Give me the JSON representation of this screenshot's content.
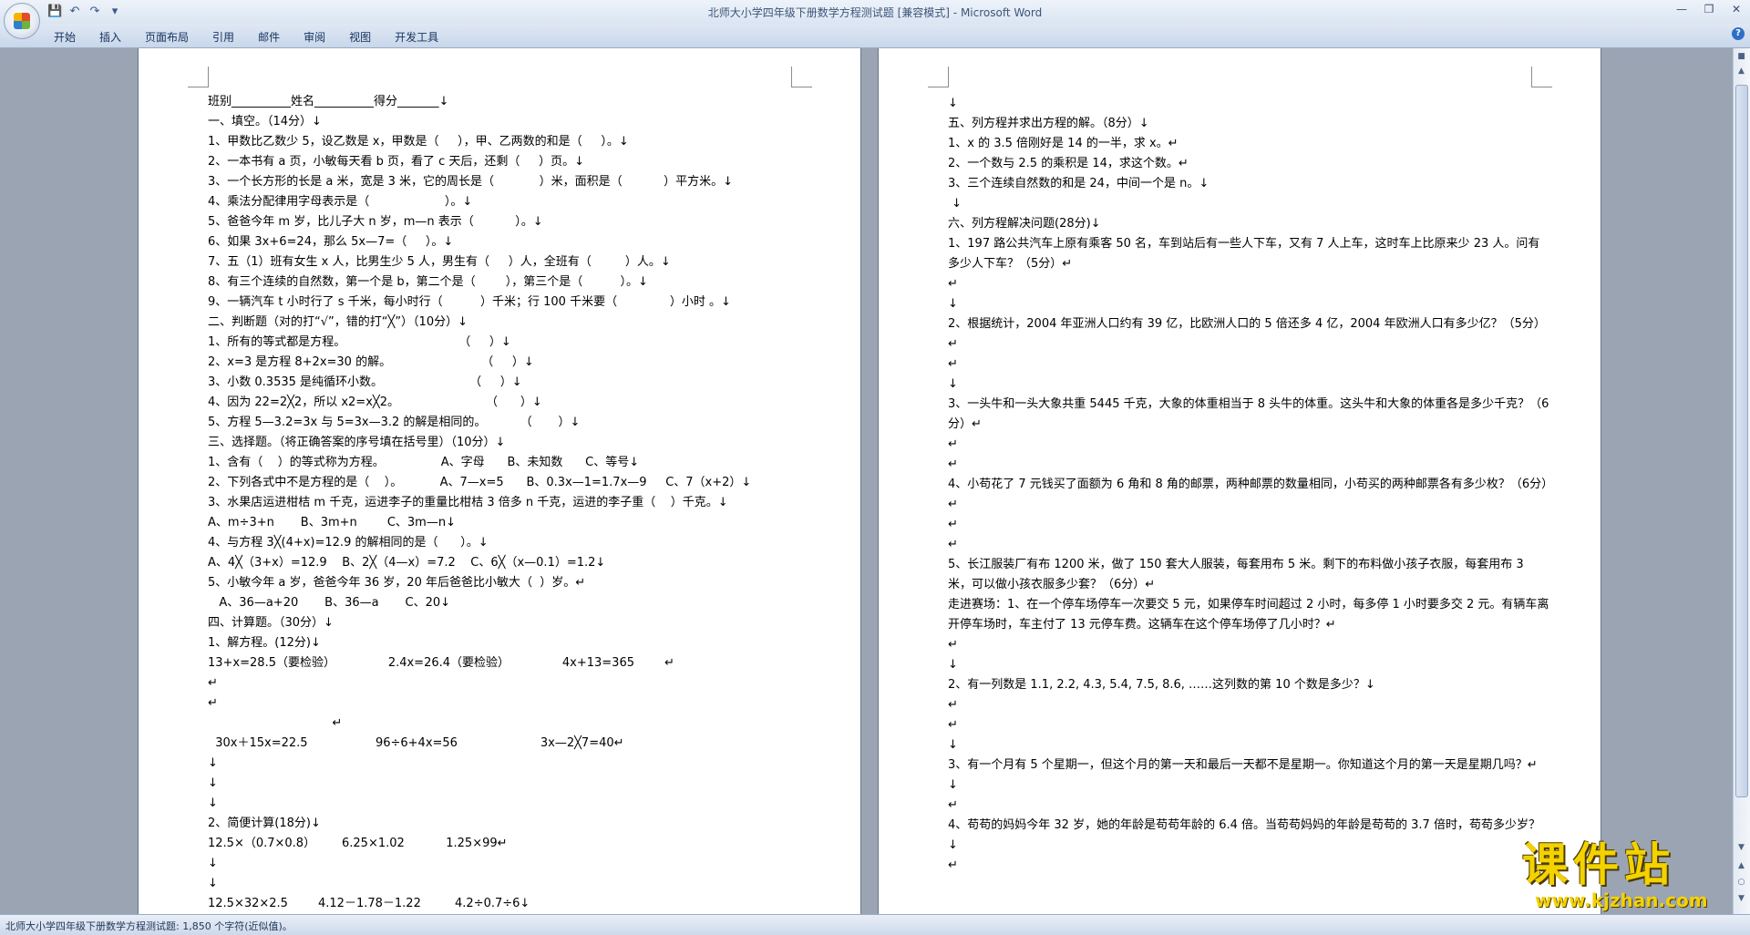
{
  "window": {
    "doc_title": "北师大小学四年级下册数学方程测试题 [兼容模式]",
    "separator": " - ",
    "app_name": "Microsoft Word"
  },
  "ribbon": {
    "tabs": [
      "开始",
      "插入",
      "页面布局",
      "引用",
      "邮件",
      "审阅",
      "视图",
      "开发工具"
    ]
  },
  "left_page": {
    "lines": [
      "班别__________姓名__________得分_______↓",
      "一、填空。（14分）↓",
      "1、甲数比乙数少 5，设乙数是 x，甲数是（     ），甲、乙两数的和是（     ）。↓",
      "2、一本书有 a 页，小敏每天看 b 页，看了 c 天后，还剩（     ）页。↓",
      "3、一个长方形的长是 a 米，宽是 3 米，它的周长是（            ）米，面积是（           ）平方米。↓",
      "4、乘法分配律用字母表示是（                    ）。↓",
      "5、爸爸今年 m 岁，比儿子大 n 岁，m—n 表示（           ）。↓",
      "6、如果 3x+6=24，那么 5x—7=（     ）。↓",
      "7、五（1）班有女生 x 人，比男生少 5 人，男生有（     ）人，全班有（         ）人。↓",
      "8、有三个连续的自然数，第一个是 b，第二个是（        ），第三个是（          ）。↓",
      "9、一辆汽车 t 小时行了 s 千米，每小时行（          ）千米；行 100 千米要（              ）小时 。↓",
      "二、判断题（对的打“√”，错的打“╳”）（10分）↓",
      "1、所有的等式都是方程。                              （     ）↓",
      "2、x=3 是方程 8+2x=30 的解。                        （     ）↓",
      "3、小数 0.3535 是纯循环小数。                       （     ）↓",
      "4、因为 22=2╳2，所以 x2=x╳2。                       （      ）↓",
      "5、方程 5—3.2=3x 与 5=3x—3.2 的解是相同的。         （       ）↓",
      "三、选择题。（将正确答案的序号填在括号里）（10分）↓",
      "1、含有（    ）的等式称为方程。               A、字母      B、未知数      C、等号↓",
      "2、下列各式中不是方程的是（    ）。          A、7—x=5      B、0.3x—1=1.7x—9     C、7（x+2）↓",
      "3、水果店运进柑桔 m 千克，运进李子的重量比柑桔 3 倍多 n 千克，运进的李子重（    ）千克。↓",
      "A、m÷3+n       B、3m+n        C、3m—n↓",
      "4、与方程 3╳(4+x)=12.9 的解相同的是（      ）。↓",
      "A、4╳（3+x）=12.9    B、2╳（4—x）=7.2    C、6╳（x—0.1）=1.2↓",
      "5、小敏今年 a 岁，爸爸今年 36 岁，20 年后爸爸比小敏大（  ）岁。↵",
      "   A、36—a+20       B、36—a       C、20↓",
      "四、计算题。（30分）↓",
      "1、解方程。(12分)↓",
      "13+x=28.5（要检验）              2.4x=26.4（要检验）              4x+13=365        ↵",
      "↵",
      "↵",
      "                                 ↵",
      "  30x＋15x=22.5                  96÷6+4x=56                      3x—2╳7=40↵",
      "↓",
      "↓",
      "↓",
      "2、简便计算(18分)↓",
      "12.5×（0.7×0.8）       6.25×1.02           1.25×99↵",
      "↓",
      "↓",
      "12.5×32×2.5        4.12－1.78－1.22         4.2÷0.7÷6↓"
    ]
  },
  "right_page": {
    "lines": [
      "↓",
      "五、列方程并求出方程的解。（8分）↓",
      "1、x 的 3.5 倍刚好是 14 的一半，求 x。↵",
      "2、一个数与 2.5 的乘积是 14，求这个数。↵",
      "3、三个连续自然数的和是 24，中间一个是 n。↓",
      " ↓",
      "六、列方程解决问题(28分)↓",
      " 1、197 路公共汽车上原有乘客 50 名，车到站后有一些人下车，又有 7 人上车，这时车上比原来少 23 人。问有多少人下车？（5分）↵",
      "↵",
      "↓",
      "  2、根据统计，2004 年亚洲人口约有 39 亿，比欧洲人口的 5 倍还多 4 亿，2004 年欧洲人口有多少亿？（5分）    ↵",
      "↵",
      "↓",
      "3、一头牛和一头大象共重 5445 千克，大象的体重相当于 8 头牛的体重。这头牛和大象的体重各是多少千克？（6分）↵",
      "↵",
      "↵",
      "4、小苟花了 7 元钱买了面额为 6 角和 8 角的邮票，两种邮票的数量相同，小苟买的两种邮票各有多少枚？（6分）↵",
      "↵",
      "↵",
      "5、长江服装厂有布 1200 米，做了 150 套大人服装，每套用布 5 米。剩下的布料做小孩子衣服，每套用布 3 米，可以做小孩衣服多少套？（6分）↵",
      "走进赛场：1、在一个停车场停车一次要交 5 元，如果停车时间超过 2 小时，每多停 1 小时要多交 2 元。有辆车离开停车场时，车主付了 13 元停车费。这辆车在这个停车场停了几小时？↵",
      "↵",
      "↓",
      "2、有一列数是 1.1, 2.2, 4.3, 5.4, 7.5, 8.6, ……这列数的第 10 个数是多少？↓",
      "↵",
      "↵",
      "↓",
      "3、有一个月有 5 个星期一，但这个月的第一天和最后一天都不是星期一。你知道这个月的第一天是星期几吗？↵",
      "↓",
      "↵",
      "4、苟苟的妈妈今年 32 岁，她的年龄是苟苟年龄的 6.4 倍。当苟苟妈妈的年龄是苟苟的 3.7 倍时，苟苟多少岁？↓",
      "↵"
    ]
  },
  "status": {
    "text": "北师大小学四年级下册数学方程测试题: 1,850 个字符(近似值)。"
  },
  "watermark": {
    "cn": "课件站",
    "url": "www.kjzhan.com"
  },
  "colors": {
    "ribbon": "#dfe8f4",
    "workspace": "#9aa4b3",
    "title_text": "#3c5578",
    "watermark": "#f4d200"
  }
}
